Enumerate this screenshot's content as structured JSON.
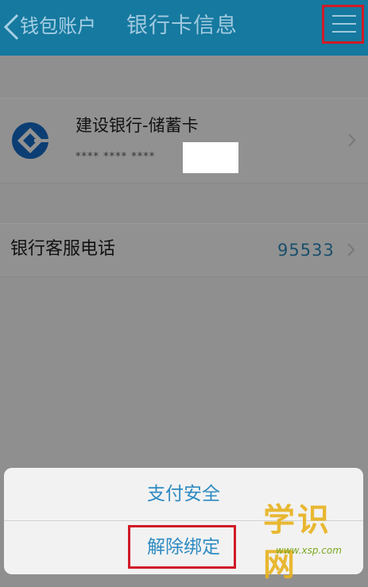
{
  "nav": {
    "back_label": "钱包账户",
    "title": "银行卡信息"
  },
  "card": {
    "bank_name": "建设银行-储蓄卡",
    "masked_number": "**** **** ****"
  },
  "service": {
    "label": "银行客服电话",
    "phone": "95533"
  },
  "sheet": {
    "items": [
      "支付安全",
      "解除绑定"
    ]
  },
  "watermark": {
    "text": "学识网",
    "sub": "www.xsp.com"
  },
  "colors": {
    "nav_bar": "#16799f",
    "accent_blue": "#2e8bc2",
    "highlight_red": "#d01b26"
  }
}
